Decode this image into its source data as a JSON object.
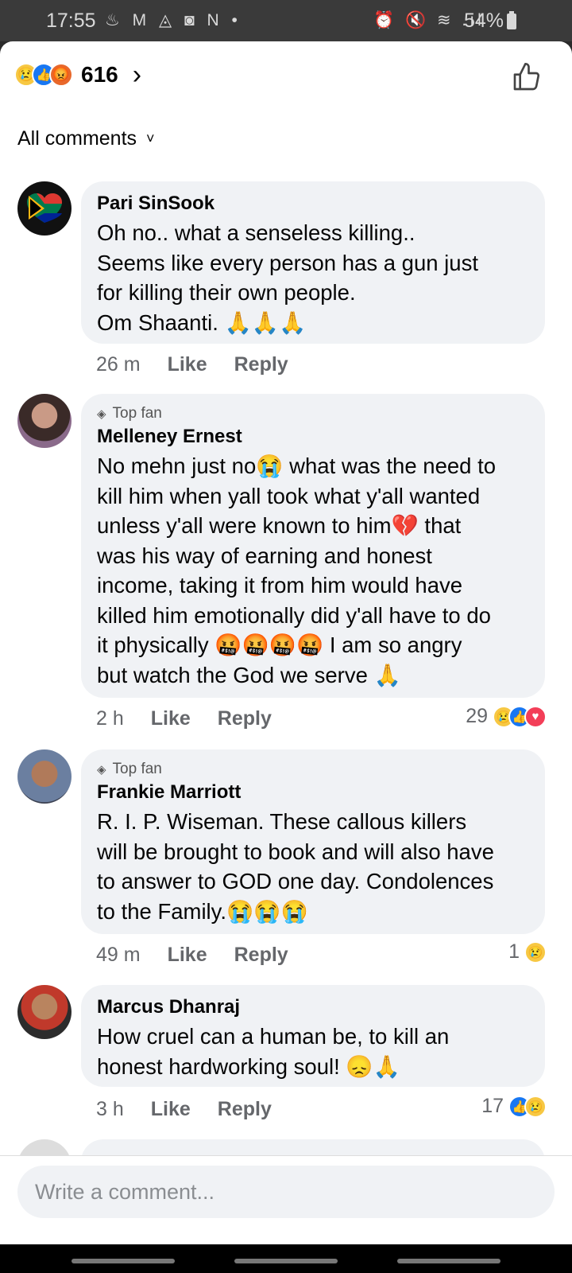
{
  "status_bar": {
    "time": "17:55",
    "left_icons": "♨ M ◬ ◙ N •",
    "right_icons": "⏰ 🔇 ≋ .ıl",
    "battery": "54%"
  },
  "header": {
    "reaction_icons": [
      "sad-reaction",
      "like-reaction",
      "angry-reaction"
    ],
    "reaction_total": "616",
    "like_icon": "thumbs-up-outline-icon"
  },
  "filter": {
    "label": "All comments"
  },
  "comments": [
    {
      "author": "Pari SinSook",
      "top_fan": "",
      "lines": [
        "Oh no.. what a senseless killing..",
        "Seems like every person has a gun just",
        "for killing their own people.",
        "Om Shaanti. 🙏🙏🙏"
      ],
      "time": "26 m",
      "like": "Like",
      "reply": "Reply",
      "reaction_count": ""
    },
    {
      "author": "Melleney Ernest",
      "top_fan": "Top fan",
      "lines": [
        "No mehn just no😭 what was the need to",
        "kill him when yall took what y'all wanted",
        "unless y'all were known to him💔 that",
        "was his way of earning and honest",
        "income, taking it from him would have",
        "killed him emotionally did y'all have to do",
        "it physically 🤬🤬🤬🤬 I am so angry",
        "but watch the God we serve 🙏"
      ],
      "time": "2 h",
      "like": "Like",
      "reply": "Reply",
      "reaction_count": "29"
    },
    {
      "author": "Frankie Marriott",
      "top_fan": "Top fan",
      "lines": [
        "R. I. P. Wiseman. These callous killers",
        "will be brought to book and will also have",
        "to answer to GOD one day. Condolences",
        "to the Family.😭😭😭"
      ],
      "time": "49 m",
      "like": "Like",
      "reply": "Reply",
      "reaction_count": "1"
    },
    {
      "author": "Marcus Dhanraj",
      "top_fan": "",
      "lines": [
        "How cruel can a human be, to kill an",
        "honest hardworking soul! 😞🙏"
      ],
      "time": "3 h",
      "like": "Like",
      "reply": "Reply",
      "reaction_count": "17"
    }
  ],
  "composer": {
    "placeholder": "Write a comment..."
  }
}
